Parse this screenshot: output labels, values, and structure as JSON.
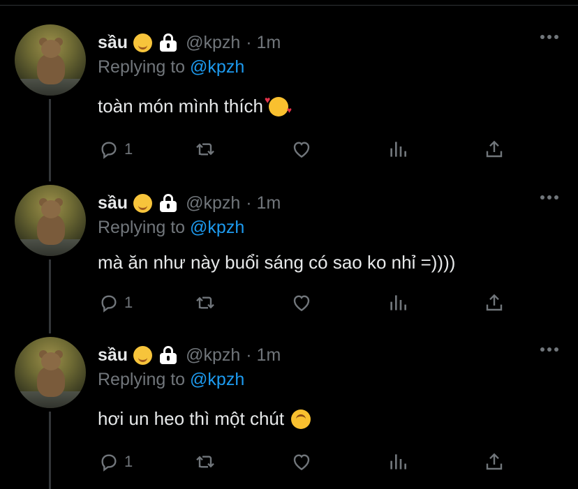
{
  "tweets": [
    {
      "name": "sầu",
      "handle": "@kpzh",
      "time": "· 1m",
      "replying_prefix": "Replying to ",
      "replying_to": "@kpzh",
      "text": "toàn món mình thích",
      "text_emoji": "smiling-face-with-hearts",
      "reply_count": "1"
    },
    {
      "name": "sầu",
      "handle": "@kpzh",
      "time": "· 1m",
      "replying_prefix": "Replying to ",
      "replying_to": "@kpzh",
      "text": "mà ăn như này buổi sáng có sao ko nhỉ =))))",
      "text_emoji": "",
      "reply_count": "1"
    },
    {
      "name": "sầu",
      "handle": "@kpzh",
      "time": "· 1m",
      "replying_prefix": "Replying to ",
      "replying_to": "@kpzh",
      "text": "hơi un heo thì một chút",
      "text_emoji": "upside-down-face",
      "reply_count": "1"
    }
  ],
  "colors": {
    "background": "#000000",
    "text": "#e7e9ea",
    "secondary": "#71767b",
    "link": "#1d9bf0"
  },
  "icons": [
    "more-icon",
    "reply-icon",
    "retweet-icon",
    "like-icon",
    "stats-icon",
    "share-icon",
    "lock-icon",
    "melting-face-icon"
  ]
}
